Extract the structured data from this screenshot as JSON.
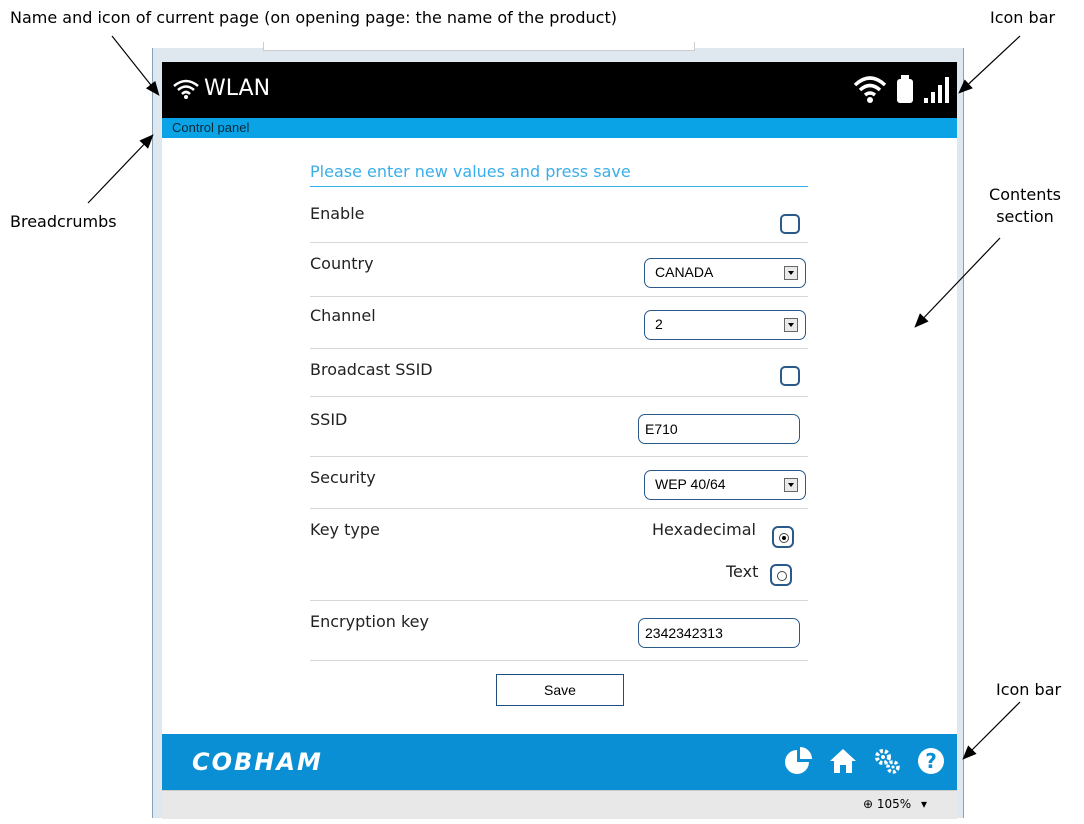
{
  "annotations": {
    "top_left": "Name and icon of current page (on opening page: the name of the product)",
    "top_right": "Icon bar",
    "breadcrumbs": "Breadcrumbs",
    "contents": "Contents section",
    "bottom_right": "Icon bar"
  },
  "header": {
    "title": "WLAN",
    "icons": [
      "wifi-icon",
      "battery-icon",
      "signal-icon"
    ]
  },
  "breadcrumb": "Control panel",
  "form": {
    "heading": "Please enter new values and press save",
    "enable_label": "Enable",
    "enable_checked": true,
    "country_label": "Country",
    "country_value": "CANADA",
    "channel_label": "Channel",
    "channel_value": "2",
    "broadcast_label": "Broadcast SSID",
    "broadcast_checked": true,
    "ssid_label": "SSID",
    "ssid_value": "E710",
    "security_label": "Security",
    "security_value": "WEP 40/64",
    "keytype_label": "Key type",
    "keytype_options": [
      "Hexadecimal",
      "Text"
    ],
    "keytype_selected": "Hexadecimal",
    "enckey_label": "Encryption key",
    "enckey_value": "2342342313",
    "save_label": "Save"
  },
  "footer": {
    "brand": "COBHAM",
    "icons": [
      "pie-chart-icon",
      "home-icon",
      "settings-icon",
      "help-icon"
    ]
  },
  "status": {
    "zoom": "105%"
  },
  "colors": {
    "accent": "#0aa3e6",
    "footer": "#0a8fd4",
    "header": "#000000",
    "heading_text": "#39aee8"
  }
}
